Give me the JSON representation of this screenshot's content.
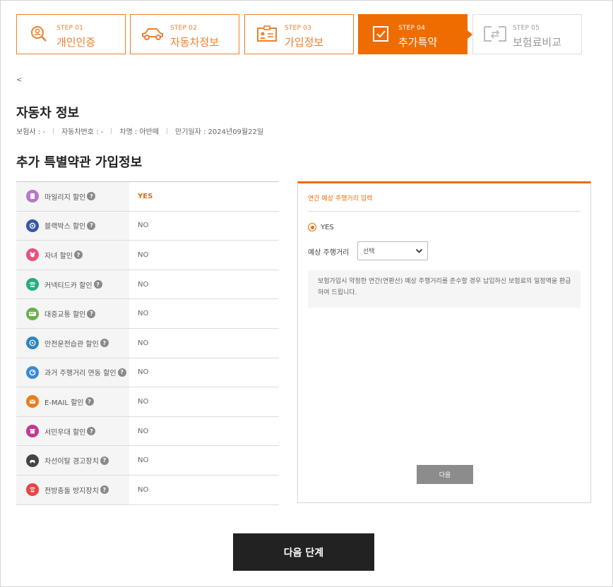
{
  "steps": [
    {
      "num": "STEP 01",
      "name": "개인인증",
      "icon": "search-person-icon",
      "state": "done"
    },
    {
      "num": "STEP 02",
      "name": "자동차정보",
      "icon": "car-icon",
      "state": "done"
    },
    {
      "num": "STEP 03",
      "name": "가입정보",
      "icon": "id-card-icon",
      "state": "done"
    },
    {
      "num": "STEP 04",
      "name": "추가특약",
      "icon": "checkbox-icon",
      "state": "active"
    },
    {
      "num": "STEP 05",
      "name": "보험료비교",
      "icon": "compare-icon",
      "state": "disabled"
    }
  ],
  "back": "<",
  "car_info": {
    "title": "자동차 정보",
    "insurer": "보험사 : -",
    "plate": "자동차번호 : -",
    "model": "차명 : 아반떼",
    "expiry": "만기일자 : 2024년09월22일"
  },
  "section_title": "추가 특별약관 가입정보",
  "options": [
    {
      "label": "마일리지 할인",
      "value": "YES",
      "icon": "mileage-icon",
      "color": "#b877c9"
    },
    {
      "label": "블랙박스 할인",
      "value": "NO",
      "icon": "blackbox-icon",
      "color": "#3558a8"
    },
    {
      "label": "자녀 할인",
      "value": "NO",
      "icon": "child-icon",
      "color": "#e8507a"
    },
    {
      "label": "커넥티드카 할인",
      "value": "NO",
      "icon": "connected-car-icon",
      "color": "#22b07d"
    },
    {
      "label": "대중교통 할인",
      "value": "NO",
      "icon": "bus-icon",
      "color": "#6ab04c"
    },
    {
      "label": "안전운전습관 할인",
      "value": "NO",
      "icon": "safe-driving-icon",
      "color": "#2e86c1"
    },
    {
      "label": "과거 주행거리 연동 할인",
      "value": "NO",
      "icon": "odometer-icon",
      "color": "#3a8bd0"
    },
    {
      "label": "E-MAIL 할인",
      "value": "NO",
      "icon": "email-icon",
      "color": "#e67e22"
    },
    {
      "label": "서민우대 할인",
      "value": "NO",
      "icon": "store-icon",
      "color": "#c0398f"
    },
    {
      "label": "차선이탈 경고장치",
      "value": "NO",
      "icon": "lane-departure-icon",
      "color": "#444444"
    },
    {
      "label": "전방충돌 방지장치",
      "value": "NO",
      "icon": "collision-icon",
      "color": "#e84545"
    }
  ],
  "panel": {
    "title": "연간 예상 주행거리 입력",
    "radio_label": "YES",
    "distance_label": "예상 주행거리",
    "select_value": "선택",
    "notice": "보험가입시 약정한 연간(연환산) 예상 주행거리를 준수할 경우 납입하신 보험료의 일정액을 환급하여 드립니다.",
    "button": "다음"
  },
  "next_button": "다음 단계",
  "colors": {
    "accent": "#ef6c00",
    "dark_button": "#222222",
    "grey_button": "#8c8c8c"
  }
}
